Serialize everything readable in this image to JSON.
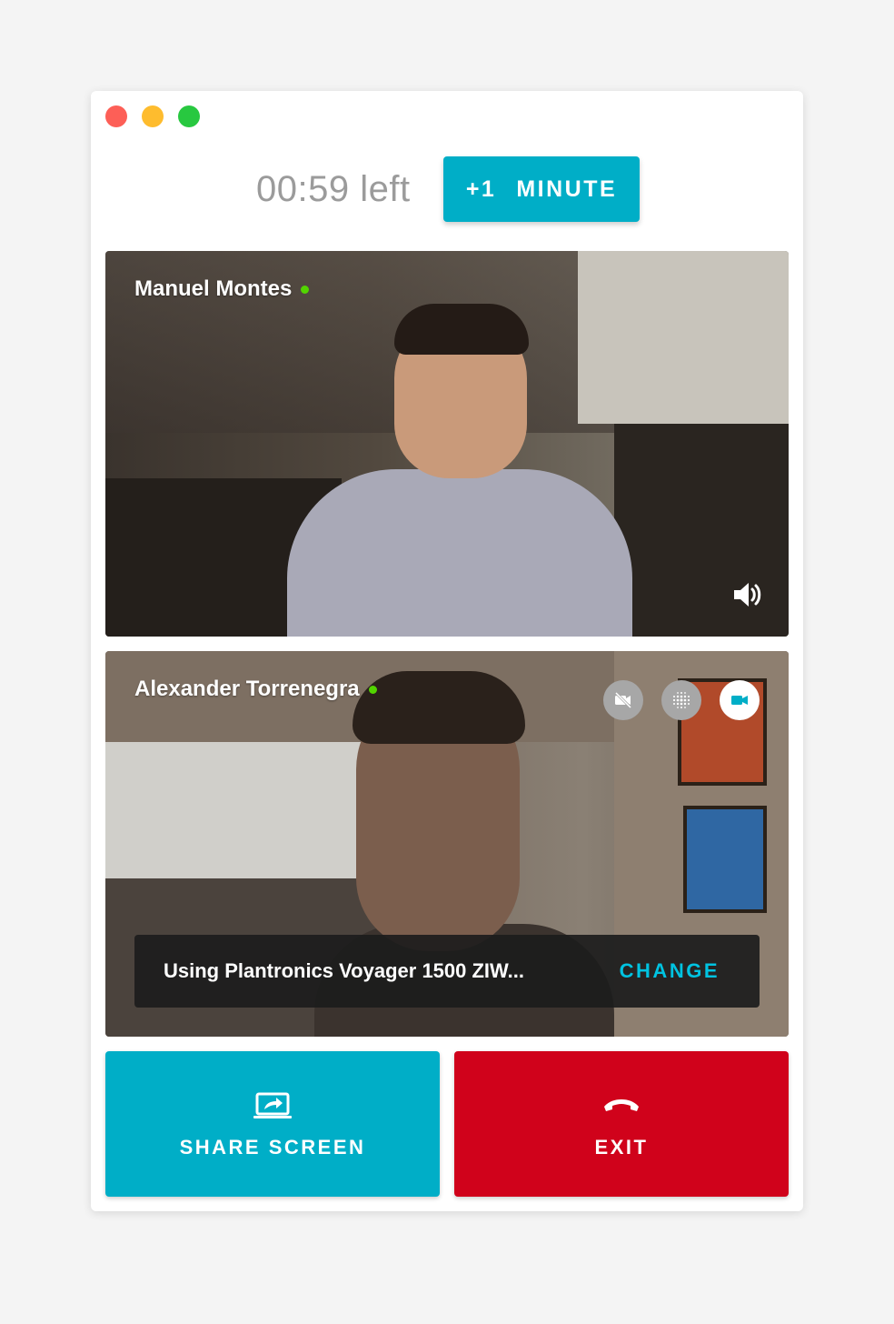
{
  "timer": {
    "remaining": "00:59 left",
    "add_plus": "+1",
    "add_label": "MINUTE"
  },
  "participants": [
    {
      "name": "Manuel Montes",
      "status": "online",
      "audio_icon": "volume-icon"
    },
    {
      "name": "Alexander Torrenegra",
      "status": "online",
      "controls": [
        "camera-off-icon",
        "blur-background-icon",
        "camera-icon"
      ]
    }
  ],
  "device": {
    "text": "Using Plantronics Voyager 1500 ZIW...",
    "change_label": "CHANGE"
  },
  "actions": {
    "share_label": "SHARE SCREEN",
    "exit_label": "EXIT"
  },
  "colors": {
    "accent": "#00aec7",
    "exit": "#d0021b",
    "online": "#52d400",
    "link": "#00c3e1"
  }
}
